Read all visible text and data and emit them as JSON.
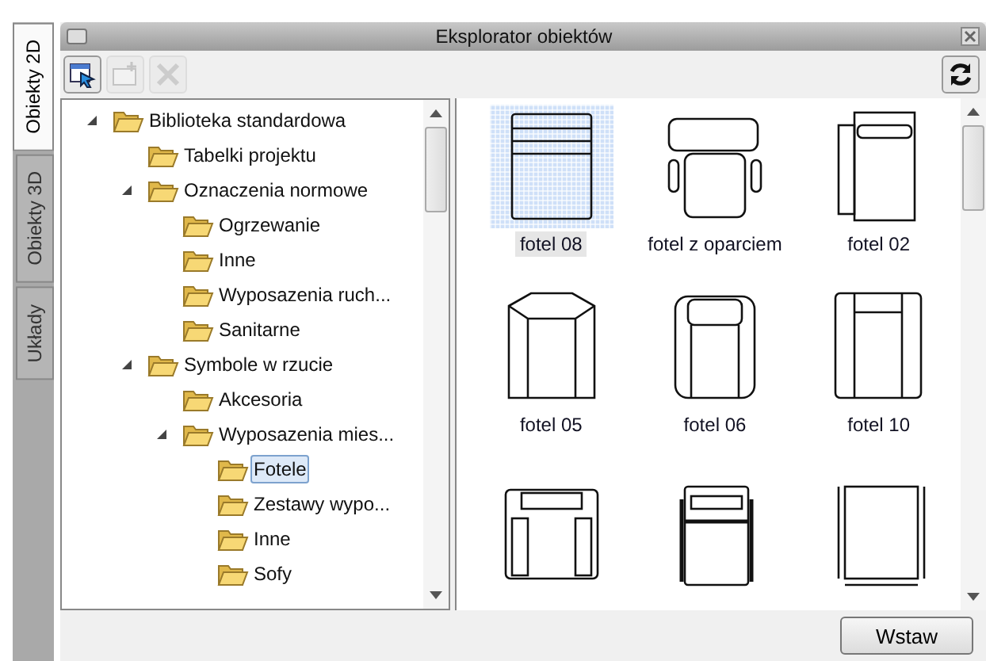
{
  "side_tabs": [
    {
      "label": "Obiekty 2D",
      "selected": true
    },
    {
      "label": "Obiekty 3D",
      "selected": false
    },
    {
      "label": "Układy",
      "selected": false
    }
  ],
  "window": {
    "title": "Eksplorator obiektów"
  },
  "toolbar": {
    "buttons": [
      {
        "disabled": false
      },
      {
        "disabled": true
      },
      {
        "disabled": true
      }
    ]
  },
  "tree": [
    {
      "label": "Biblioteka standardowa",
      "expanded": true,
      "selected": false,
      "children": [
        {
          "label": "Tabelki projektu",
          "expanded": false,
          "selected": false
        },
        {
          "label": "Oznaczenia normowe",
          "expanded": true,
          "selected": false,
          "children": [
            {
              "label": "Ogrzewanie",
              "expanded": false,
              "selected": false
            },
            {
              "label": "Inne",
              "expanded": false,
              "selected": false
            },
            {
              "label": "Wyposazenia ruch...",
              "expanded": false,
              "selected": false
            },
            {
              "label": "Sanitarne",
              "expanded": false,
              "selected": false
            }
          ]
        },
        {
          "label": "Symbole w rzucie",
          "expanded": true,
          "selected": false,
          "children": [
            {
              "label": "Akcesoria",
              "expanded": false,
              "selected": false
            },
            {
              "label": "Wyposazenia mies...",
              "expanded": true,
              "selected": false,
              "children": [
                {
                  "label": "Fotele",
                  "expanded": false,
                  "selected": true
                },
                {
                  "label": "Zestawy wypo...",
                  "expanded": false,
                  "selected": false
                },
                {
                  "label": "Inne",
                  "expanded": false,
                  "selected": false
                },
                {
                  "label": "Sofy",
                  "expanded": false,
                  "selected": false
                }
              ]
            }
          ]
        }
      ]
    }
  ],
  "gallery": [
    {
      "label": "fotel 08",
      "selected": true
    },
    {
      "label": "fotel z oparciem",
      "selected": false
    },
    {
      "label": "fotel 02",
      "selected": false
    },
    {
      "label": "fotel 05",
      "selected": false
    },
    {
      "label": "fotel 06",
      "selected": false
    },
    {
      "label": "fotel 10",
      "selected": false
    },
    {
      "selected": false
    },
    {
      "selected": false
    },
    {
      "selected": false
    }
  ],
  "insert_button": "Wstaw"
}
